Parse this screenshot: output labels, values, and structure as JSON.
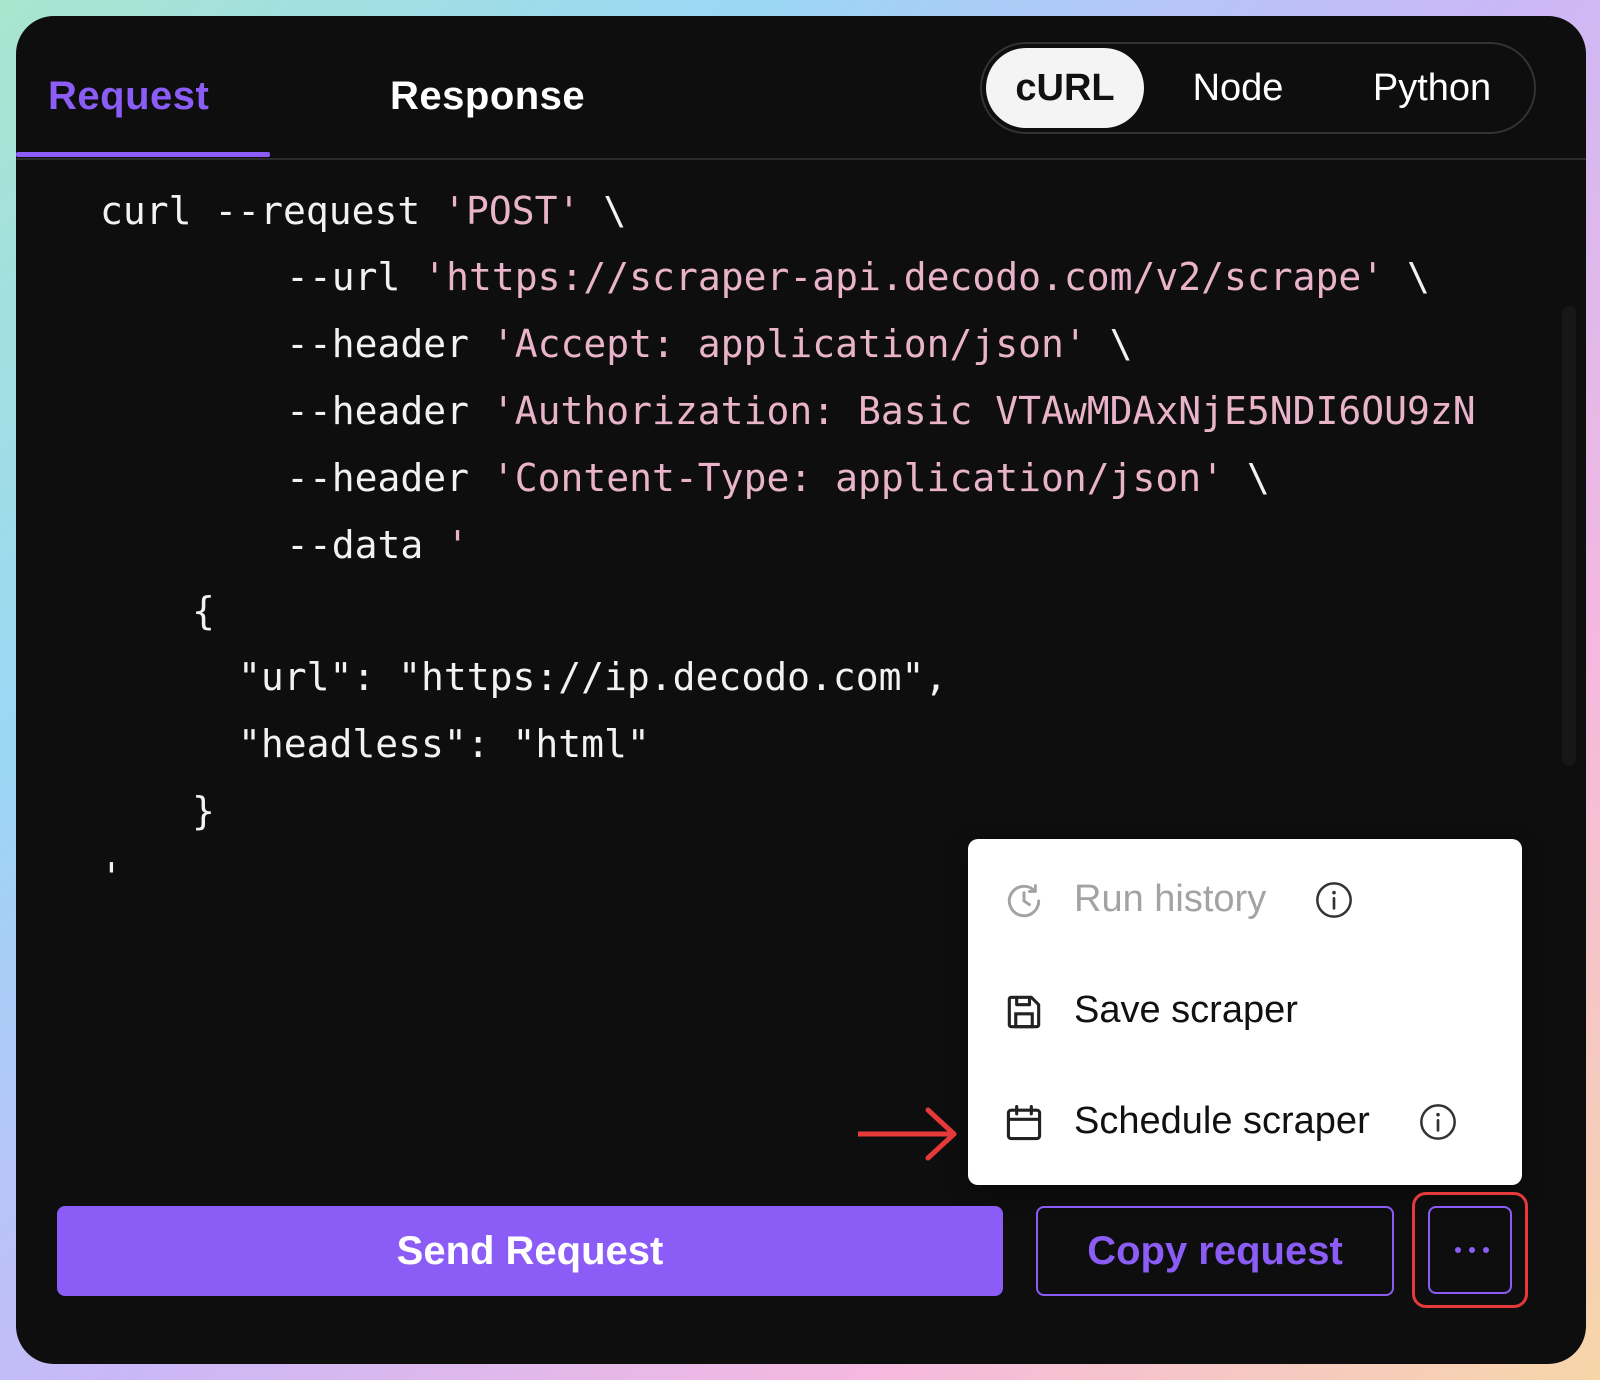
{
  "tabs": {
    "request": "Request",
    "response": "Response"
  },
  "languages": {
    "curl": "cURL",
    "node": "Node",
    "python": "Python",
    "selected": "cURL"
  },
  "code": {
    "l1_cmd": "curl --request ",
    "l1_str": "'POST'",
    "l1_end": " \\",
    "l2_cmd": "--url ",
    "l2_str": "'https://scraper-api.decodo.com/v2/scrape'",
    "l2_end": " \\",
    "l3_cmd": "--header ",
    "l3_str": "'Accept: application/json'",
    "l3_end": " \\",
    "l4_cmd": "--header ",
    "l4_str": "'Authorization: Basic VTAwMDAxNjE5NDI6OU9zN",
    "l5_cmd": "--header ",
    "l5_str": "'Content-Type: application/json'",
    "l5_end": " \\",
    "l6_cmd": "--data ",
    "l6_str": "'",
    "l7": "{",
    "l8": "\"url\": \"https://ip.decodo.com\",",
    "l9": "\"headless\": \"html\"",
    "l10": "}",
    "l11": "'"
  },
  "menu": {
    "run_history": "Run history",
    "save_scraper": "Save scraper",
    "schedule_scraper": "Schedule scraper"
  },
  "actions": {
    "send": "Send Request",
    "copy": "Copy request"
  },
  "colors": {
    "accent": "#8b5cf6",
    "highlight": "#e5393a",
    "code_string": "#e9b4c9"
  }
}
